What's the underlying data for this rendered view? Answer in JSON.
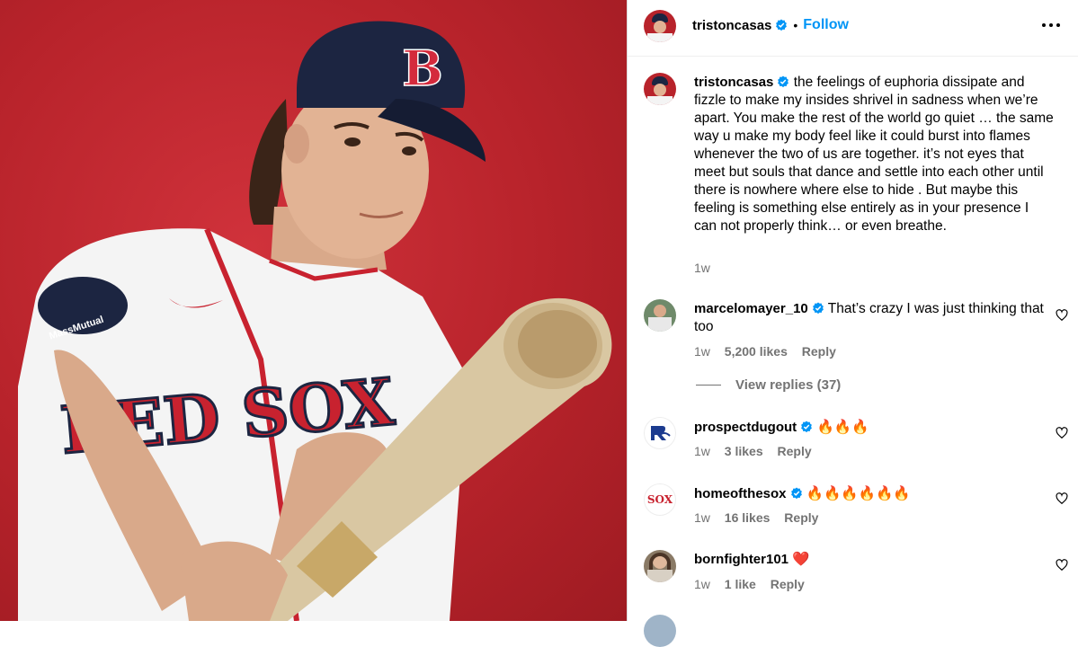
{
  "post": {
    "author": "tristoncasas",
    "follow_label": "Follow",
    "separator": "•",
    "more_icon": "more-horizontal-icon",
    "caption": "the feelings of euphoria dissipate and fizzle to make my insides shrivel in sadness when we’re apart. You make the rest of the world go quiet … the same way u make my body feel like it could burst into flames whenever the two of us are together. it’s not eyes that meet but souls that dance and settle into each other until there is nowhere where else to hide . But maybe this feeling is something else entirely as in your presence I can not properly think… or even breathe.",
    "caption_time": "1w"
  },
  "comments": [
    {
      "user": "marcelomayer_10",
      "verified": true,
      "text": "That’s crazy I was just thinking that too",
      "time": "1w",
      "likes": "5,200 likes",
      "reply": "Reply",
      "view_replies": "View replies (37)"
    },
    {
      "user": "prospectdugout",
      "verified": true,
      "text": "🔥🔥🔥",
      "time": "1w",
      "likes": "3 likes",
      "reply": "Reply"
    },
    {
      "user": "homeofthesox",
      "verified": true,
      "text": "🔥🔥🔥🔥🔥🔥",
      "time": "1w",
      "likes": "16 likes",
      "reply": "Reply"
    },
    {
      "user": "bornfighter101",
      "verified": false,
      "text": "❤️",
      "time": "1w",
      "likes": "1 like",
      "reply": "Reply"
    }
  ],
  "photo": {
    "cap_letter": "B",
    "patch_text": "MassMutual",
    "jersey_text": "RED SOX"
  },
  "avatars": {
    "homeofthesox": "SOX"
  },
  "colors": {
    "accent": "#0095f6",
    "verified": "#0095f6",
    "muted": "#737373",
    "backdrop": "#b8232b"
  }
}
